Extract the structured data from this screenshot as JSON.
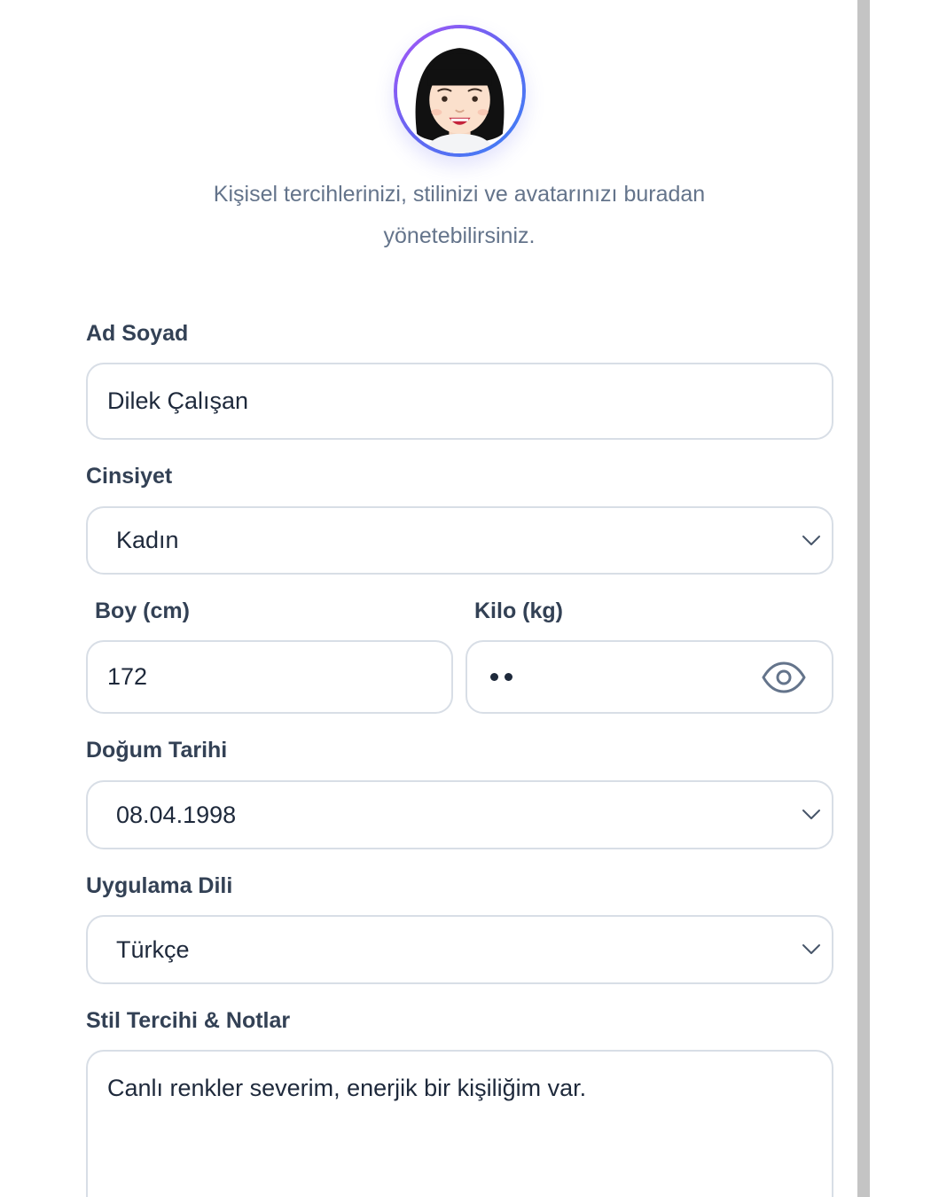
{
  "profile": {
    "subtitle": "Kişisel tercihlerinizi, stilinizi ve avatarınızı buradan yönetebilirsiniz."
  },
  "form": {
    "name": {
      "label": "Ad Soyad",
      "value": "Dilek Çalışan"
    },
    "gender": {
      "label": "Cinsiyet",
      "value": "Kadın"
    },
    "height": {
      "label": "Boy (cm)",
      "value": "172"
    },
    "weight": {
      "label": "Kilo (kg)",
      "masked_value": "••"
    },
    "birthdate": {
      "label": "Doğum Tarihi",
      "value": "08.04.1998"
    },
    "language": {
      "label": "Uygulama Dili",
      "value": "Türkçe"
    },
    "notes": {
      "label": "Stil Tercihi & Notlar",
      "value": "Canlı renkler severim, enerjik bir kişiliğim var."
    }
  },
  "icons": {
    "avatar": "avatar-girl-black-bob",
    "select_arrow": "chevron-down-icon",
    "password_toggle": "eye-icon"
  },
  "colors": {
    "avatar_ring_start": "#a855f7",
    "avatar_ring_end": "#3b82f6",
    "field_border": "#d8dee6",
    "label": "#334155",
    "muted_text": "#64748b"
  }
}
